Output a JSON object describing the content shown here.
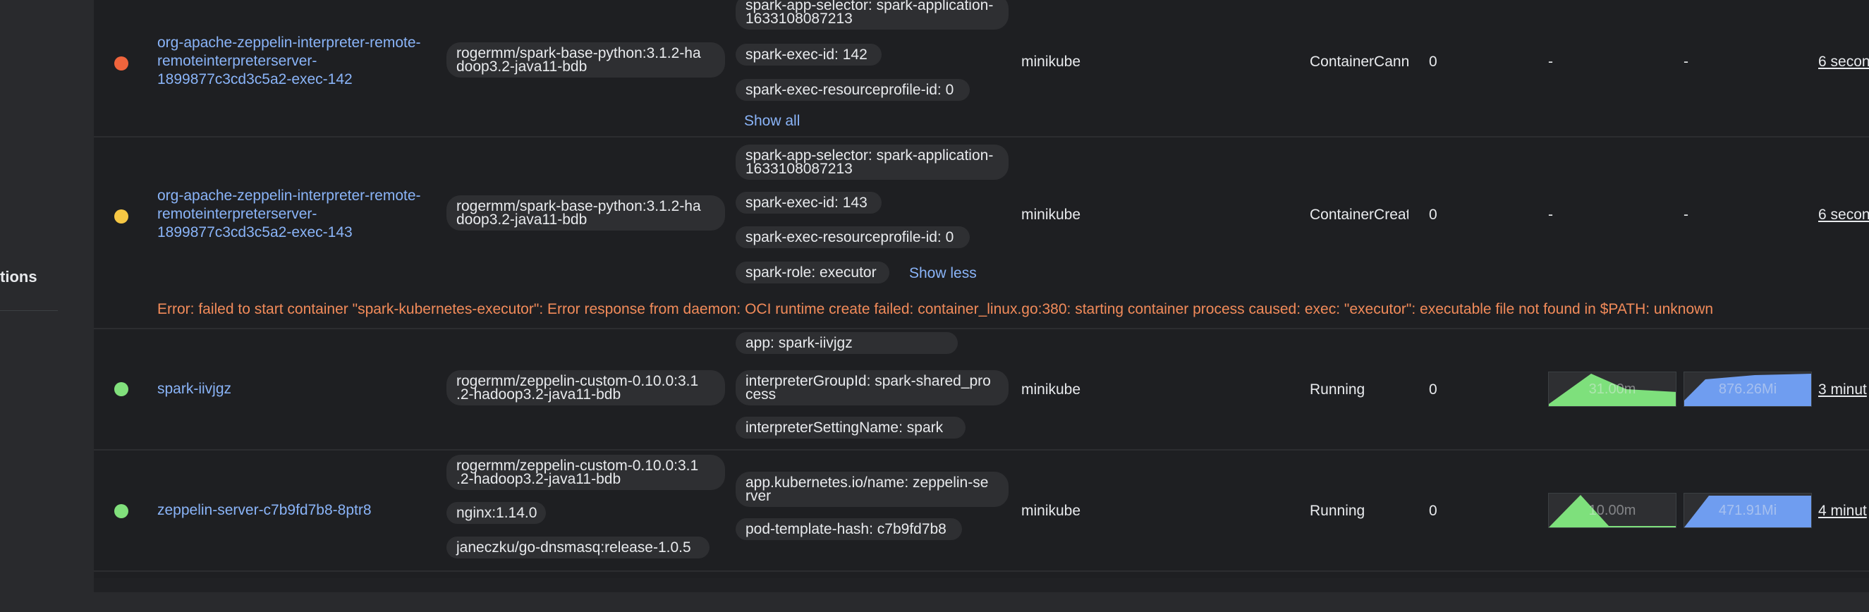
{
  "sidebar": {
    "partial_label": "tions"
  },
  "rows": [
    {
      "status_color": "#f0643c",
      "name_lines": [
        "org-apache-zeppelin-interpreter-remote-",
        "remoteinterpreterserver-",
        "1899877c3cd3c5a2-exec-142"
      ],
      "images": [
        "rogermm/spark-base-python:3.1.2-ha doop3.2-java11-bdb"
      ],
      "labels": [
        "spark-app-selector: spark-application-1633108087213",
        "spark-exec-id: 142",
        "spark-exec-resourceprofile-id: 0"
      ],
      "toggle_label": "Show all",
      "node": "minikube",
      "status": "ContainerCannot",
      "restarts": "0",
      "cpu": "-",
      "memory": "-",
      "age": "6 secon"
    },
    {
      "status_color": "#f6c744",
      "name_lines": [
        "org-apache-zeppelin-interpreter-remote-",
        "remoteinterpreterserver-",
        "1899877c3cd3c5a2-exec-143"
      ],
      "images": [
        "rogermm/spark-base-python:3.1.2-ha doop3.2-java11-bdb"
      ],
      "labels": [
        "spark-app-selector: spark-application-1633108087213",
        "spark-exec-id: 143",
        "spark-exec-resourceprofile-id: 0",
        "spark-role: executor"
      ],
      "toggle_label": "Show less",
      "node": "minikube",
      "status": "ContainerCreatin",
      "restarts": "0",
      "cpu": "-",
      "memory": "-",
      "age": "6 secon",
      "error": "Error: failed to start container \"spark-kubernetes-executor\": Error response from daemon: OCI runtime create failed: container_linux.go:380: starting container process caused: exec: \"executor\": executable file not found in $PATH: unknown"
    },
    {
      "status_color": "#81e07c",
      "name": "spark-iivjgz",
      "images": [
        "rogermm/zeppelin-custom-0.10.0:3.1 .2-hadoop3.2-java11-bdb"
      ],
      "labels": [
        "app: spark-iivjgz",
        "interpreterGroupId: spark-shared_pro cess",
        "interpreterSettingName: spark"
      ],
      "node": "minikube",
      "status": "Running",
      "restarts": "0",
      "cpu": "31.00m",
      "memory": "876.26Mi",
      "age": "3 minut"
    },
    {
      "status_color": "#81e07c",
      "name": "zeppelin-server-c7b9fd7b8-8ptr8",
      "images": [
        "rogermm/zeppelin-custom-0.10.0:3.1 .2-hadoop3.2-java11-bdb",
        "nginx:1.14.0",
        "janeczku/go-dnsmasq:release-1.0.5"
      ],
      "labels": [
        "app.kubernetes.io/name: zeppelin-se rver",
        "pod-template-hash: c7b9fd7b8"
      ],
      "node": "minikube",
      "status": "Running",
      "restarts": "0",
      "cpu": "10.00m",
      "memory": "471.91Mi",
      "age": "4 minut"
    }
  ],
  "colors": {
    "cpu_fill": "#7ee07c",
    "mem_fill": "#6f9df0",
    "error_text": "#f28b5a",
    "link": "#8ab4f8"
  }
}
